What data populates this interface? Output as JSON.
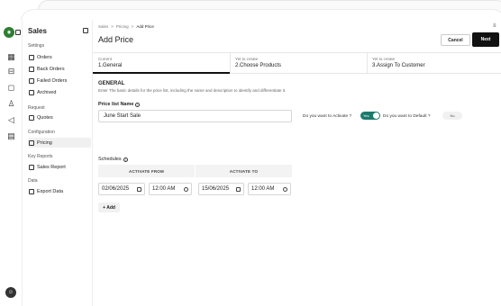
{
  "sidebar": {
    "title": "Sales",
    "sections": {
      "settings": "Settings",
      "request": "Request",
      "configuration": "Configuration",
      "key_reports": "Key Reports",
      "data": "Data"
    },
    "items": [
      {
        "label": "Orders",
        "icon": "orders-icon"
      },
      {
        "label": "Back Orders",
        "icon": "back-orders-icon"
      },
      {
        "label": "Failed Orders",
        "icon": "failed-orders-icon"
      },
      {
        "label": "Archived",
        "icon": "archived-icon"
      },
      {
        "label": "Quotes",
        "icon": "quotes-icon"
      },
      {
        "label": "Pricing",
        "icon": "pricing-icon"
      },
      {
        "label": "Sales Report",
        "icon": "sales-report-icon"
      },
      {
        "label": "Export Data",
        "icon": "export-data-icon"
      }
    ]
  },
  "breadcrumb": {
    "items": [
      "Sales",
      "Pricing",
      "Add Price"
    ],
    "separator": ">"
  },
  "header": {
    "title": "Add Price",
    "cancel_label": "Cancel",
    "next_label": "Next"
  },
  "steps": [
    {
      "status": "Current",
      "label": "1.General"
    },
    {
      "status": "Yet to create",
      "label": "2.Choose Products"
    },
    {
      "status": "Yet to create",
      "label": "3.Assign To Customer"
    }
  ],
  "general": {
    "title": "GENERAL",
    "description": "Enter The basic details for the price list, including the name and description to identify and differentiate it.",
    "price_list_label": "Price list Name",
    "price_list_value": "June Start Sale",
    "activate_question": "Do you want to Activate ?",
    "activate_value": "Yes",
    "default_question": "Do you want to Default ?",
    "default_value": "No"
  },
  "schedules": {
    "label": "Schedules",
    "col_from": "ACTIVATE FROM",
    "col_to": "ACTIVATE TO",
    "from_date": "02/06/2025",
    "from_time": "12:00 AM",
    "to_date": "15/06/2025",
    "to_time": "12:00 AM",
    "add_label": "+ Add"
  },
  "colors": {
    "accent": "#1b7a6c",
    "primary_button": "#111111"
  }
}
